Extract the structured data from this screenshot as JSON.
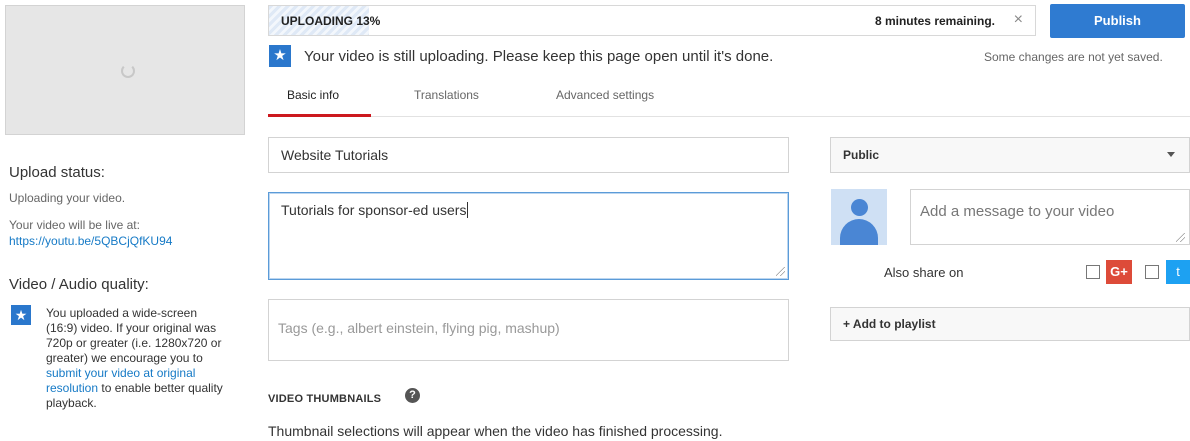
{
  "left": {
    "upload_status_heading": "Upload status:",
    "upload_status_text": "Uploading your video.",
    "live_at_text": "Your video will be live at:",
    "video_url": "https://youtu.be/5QBCjQfKU94",
    "quality_heading": "Video / Audio quality:",
    "quality_pre": "You uploaded a wide-screen (16:9) video. If your original was 720p or greater (i.e. 1280x720 or greater) we encourage you to ",
    "quality_link": "submit your video at original resolution",
    "quality_post": " to enable better quality playback."
  },
  "upload": {
    "label": "UPLOADING 13%",
    "percent": 13,
    "remaining": "8 minutes remaining.",
    "close_glyph": "×"
  },
  "publish_label": "Publish",
  "notice": {
    "text": "Your video is still uploading. Please keep this page open until it's done.",
    "unsaved": "Some changes are not yet saved."
  },
  "tabs": [
    {
      "label": "Basic info",
      "active": true
    },
    {
      "label": "Translations",
      "active": false
    },
    {
      "label": "Advanced settings",
      "active": false
    }
  ],
  "form": {
    "title_value": "Website Tutorials",
    "description_value": "Tutorials for sponsor-ed users",
    "tags_placeholder": "Tags (e.g., albert einstein, flying pig, mashup)"
  },
  "privacy": {
    "selected": "Public"
  },
  "share": {
    "message_placeholder": "Add a message to your video",
    "also_share_label": "Also share on",
    "gplus_glyph": "G+",
    "twitter_glyph": "t"
  },
  "playlist_label": "+ Add to playlist",
  "thumbnails": {
    "heading": "VIDEO THUMBNAILS",
    "help_glyph": "?",
    "message": "Thumbnail selections will appear when the video has finished processing."
  },
  "colors": {
    "accent": "#2f7bd1",
    "tab_active": "#cc181e",
    "link": "#167ac6",
    "gplus": "#dd4b39",
    "twitter": "#1da1f2"
  },
  "icons": [
    "spinner-icon",
    "star-icon",
    "close-icon",
    "chevron-down-icon",
    "avatar-icon",
    "google-plus-icon",
    "twitter-icon",
    "help-icon",
    "resize-grip-icon"
  ]
}
